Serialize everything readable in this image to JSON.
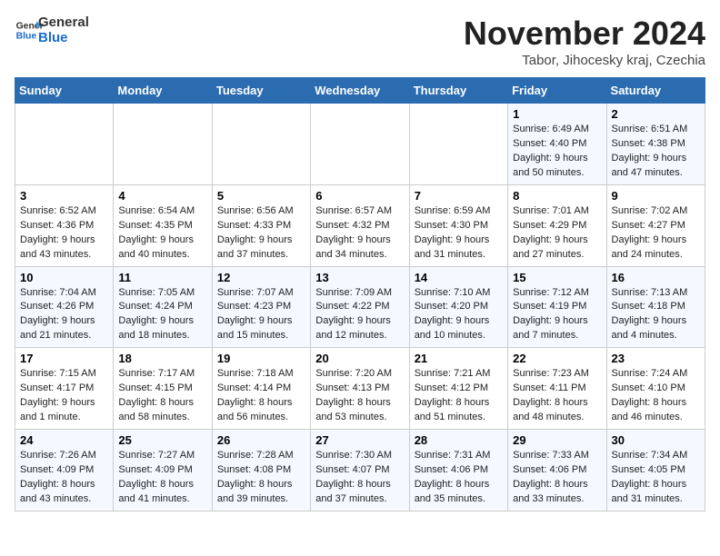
{
  "logo": {
    "line1": "General",
    "line2": "Blue"
  },
  "title": "November 2024",
  "location": "Tabor, Jihocesky kraj, Czechia",
  "days_of_week": [
    "Sunday",
    "Monday",
    "Tuesday",
    "Wednesday",
    "Thursday",
    "Friday",
    "Saturday"
  ],
  "weeks": [
    [
      {
        "day": "",
        "info": ""
      },
      {
        "day": "",
        "info": ""
      },
      {
        "day": "",
        "info": ""
      },
      {
        "day": "",
        "info": ""
      },
      {
        "day": "",
        "info": ""
      },
      {
        "day": "1",
        "info": "Sunrise: 6:49 AM\nSunset: 4:40 PM\nDaylight: 9 hours\nand 50 minutes."
      },
      {
        "day": "2",
        "info": "Sunrise: 6:51 AM\nSunset: 4:38 PM\nDaylight: 9 hours\nand 47 minutes."
      }
    ],
    [
      {
        "day": "3",
        "info": "Sunrise: 6:52 AM\nSunset: 4:36 PM\nDaylight: 9 hours\nand 43 minutes."
      },
      {
        "day": "4",
        "info": "Sunrise: 6:54 AM\nSunset: 4:35 PM\nDaylight: 9 hours\nand 40 minutes."
      },
      {
        "day": "5",
        "info": "Sunrise: 6:56 AM\nSunset: 4:33 PM\nDaylight: 9 hours\nand 37 minutes."
      },
      {
        "day": "6",
        "info": "Sunrise: 6:57 AM\nSunset: 4:32 PM\nDaylight: 9 hours\nand 34 minutes."
      },
      {
        "day": "7",
        "info": "Sunrise: 6:59 AM\nSunset: 4:30 PM\nDaylight: 9 hours\nand 31 minutes."
      },
      {
        "day": "8",
        "info": "Sunrise: 7:01 AM\nSunset: 4:29 PM\nDaylight: 9 hours\nand 27 minutes."
      },
      {
        "day": "9",
        "info": "Sunrise: 7:02 AM\nSunset: 4:27 PM\nDaylight: 9 hours\nand 24 minutes."
      }
    ],
    [
      {
        "day": "10",
        "info": "Sunrise: 7:04 AM\nSunset: 4:26 PM\nDaylight: 9 hours\nand 21 minutes."
      },
      {
        "day": "11",
        "info": "Sunrise: 7:05 AM\nSunset: 4:24 PM\nDaylight: 9 hours\nand 18 minutes."
      },
      {
        "day": "12",
        "info": "Sunrise: 7:07 AM\nSunset: 4:23 PM\nDaylight: 9 hours\nand 15 minutes."
      },
      {
        "day": "13",
        "info": "Sunrise: 7:09 AM\nSunset: 4:22 PM\nDaylight: 9 hours\nand 12 minutes."
      },
      {
        "day": "14",
        "info": "Sunrise: 7:10 AM\nSunset: 4:20 PM\nDaylight: 9 hours\nand 10 minutes."
      },
      {
        "day": "15",
        "info": "Sunrise: 7:12 AM\nSunset: 4:19 PM\nDaylight: 9 hours\nand 7 minutes."
      },
      {
        "day": "16",
        "info": "Sunrise: 7:13 AM\nSunset: 4:18 PM\nDaylight: 9 hours\nand 4 minutes."
      }
    ],
    [
      {
        "day": "17",
        "info": "Sunrise: 7:15 AM\nSunset: 4:17 PM\nDaylight: 9 hours\nand 1 minute."
      },
      {
        "day": "18",
        "info": "Sunrise: 7:17 AM\nSunset: 4:15 PM\nDaylight: 8 hours\nand 58 minutes."
      },
      {
        "day": "19",
        "info": "Sunrise: 7:18 AM\nSunset: 4:14 PM\nDaylight: 8 hours\nand 56 minutes."
      },
      {
        "day": "20",
        "info": "Sunrise: 7:20 AM\nSunset: 4:13 PM\nDaylight: 8 hours\nand 53 minutes."
      },
      {
        "day": "21",
        "info": "Sunrise: 7:21 AM\nSunset: 4:12 PM\nDaylight: 8 hours\nand 51 minutes."
      },
      {
        "day": "22",
        "info": "Sunrise: 7:23 AM\nSunset: 4:11 PM\nDaylight: 8 hours\nand 48 minutes."
      },
      {
        "day": "23",
        "info": "Sunrise: 7:24 AM\nSunset: 4:10 PM\nDaylight: 8 hours\nand 46 minutes."
      }
    ],
    [
      {
        "day": "24",
        "info": "Sunrise: 7:26 AM\nSunset: 4:09 PM\nDaylight: 8 hours\nand 43 minutes."
      },
      {
        "day": "25",
        "info": "Sunrise: 7:27 AM\nSunset: 4:09 PM\nDaylight: 8 hours\nand 41 minutes."
      },
      {
        "day": "26",
        "info": "Sunrise: 7:28 AM\nSunset: 4:08 PM\nDaylight: 8 hours\nand 39 minutes."
      },
      {
        "day": "27",
        "info": "Sunrise: 7:30 AM\nSunset: 4:07 PM\nDaylight: 8 hours\nand 37 minutes."
      },
      {
        "day": "28",
        "info": "Sunrise: 7:31 AM\nSunset: 4:06 PM\nDaylight: 8 hours\nand 35 minutes."
      },
      {
        "day": "29",
        "info": "Sunrise: 7:33 AM\nSunset: 4:06 PM\nDaylight: 8 hours\nand 33 minutes."
      },
      {
        "day": "30",
        "info": "Sunrise: 7:34 AM\nSunset: 4:05 PM\nDaylight: 8 hours\nand 31 minutes."
      }
    ]
  ]
}
